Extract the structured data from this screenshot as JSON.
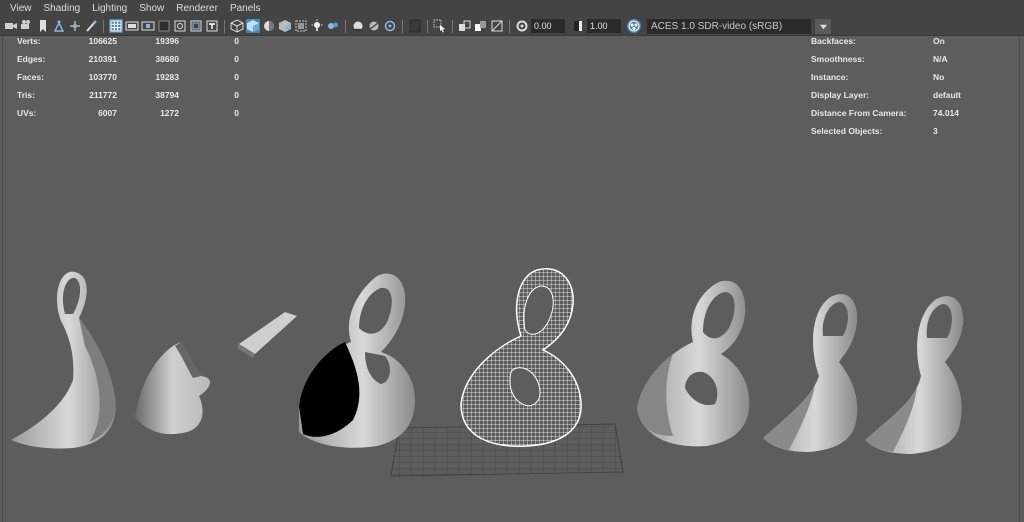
{
  "menubar": {
    "items": [
      "View",
      "Shading",
      "Lighting",
      "Show",
      "Renderer",
      "Panels"
    ]
  },
  "toolbar": {
    "icons": [
      "camera-icon",
      "camera-attributes-icon",
      "bookmark-icon",
      "image-plane-icon",
      "grease-pencil-icon",
      "2d-pan-zoom-icon",
      "grid-icon",
      "film-gate-icon",
      "resolution-gate-icon",
      "gate-mask-icon",
      "field-chart-icon",
      "safe-action-icon",
      "safe-title-icon",
      "wireframe-icon",
      "smooth-shade-icon",
      "default-material-icon",
      "shadows-icon",
      "xray-icon",
      "lights-icon",
      "ambient-occlusion-icon",
      "motion-blur-icon",
      "anti-alias-icon",
      "depth-of-field-icon",
      "isolate-select-icon",
      "select-camera-icon",
      "xray-joints-icon",
      "xray-active-icon",
      "backface-culling-icon",
      "exposure-icon",
      "gamma-icon",
      "color-management-icon",
      "dropdown-arrow-icon"
    ],
    "exposure_value": "0.00",
    "gamma_value": "1.00",
    "color_space": "ACES 1.0 SDR-video (sRGB)"
  },
  "hud_left": {
    "rows": [
      {
        "label": "Verts:",
        "v1": "106625",
        "v2": "19396",
        "v3": "0"
      },
      {
        "label": "Edges:",
        "v1": "210391",
        "v2": "38680",
        "v3": "0"
      },
      {
        "label": "Faces:",
        "v1": "103770",
        "v2": "19283",
        "v3": "0"
      },
      {
        "label": "Tris:",
        "v1": "211772",
        "v2": "38794",
        "v3": "0"
      },
      {
        "label": "UVs:",
        "v1": "6007",
        "v2": "1272",
        "v3": "0"
      }
    ]
  },
  "hud_right": {
    "rows": [
      {
        "label": "Backfaces:",
        "value": "On"
      },
      {
        "label": "Smoothness:",
        "value": "N/A"
      },
      {
        "label": "Instance:",
        "value": "No"
      },
      {
        "label": "Display Layer:",
        "value": "default"
      },
      {
        "label": "Distance From Camera:",
        "value": "74.014"
      },
      {
        "label": "Selected Objects:",
        "value": "3"
      }
    ]
  },
  "colors": {
    "ui_bg": "#444444",
    "viewport_bg": "#5d5d5d",
    "active_blue": "#5285a6",
    "wire_white": "#ffffff"
  }
}
